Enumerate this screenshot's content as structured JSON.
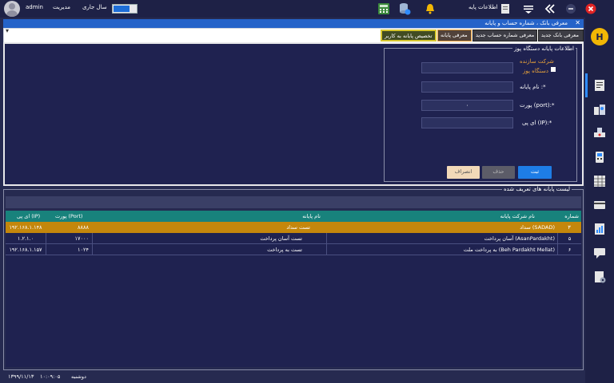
{
  "topbar": {
    "user": "admin",
    "role": "مدیریت",
    "fiscal_year_label": "سال جاری",
    "base_info_label": "اطلاعات پایه"
  },
  "window": {
    "title": "معرفی بانک ، شماره حساب و پایانه",
    "tabs": [
      "معرفی بانک جدید",
      "معرفی شماره حساب جدید",
      "معرفی پایانه",
      "تخصیص پایانه به کاربر"
    ]
  },
  "form": {
    "legend": "اطلاعات پایانه دستگاه پوز",
    "maker_label_line1": "شرکت سازنده",
    "maker_label_line2": "دستگاه پوز",
    "terminal_name_label": "نام پایانه :*",
    "port_label": "پورت (port):*",
    "port_value": "۰",
    "ip_label": "ای پی (IP):*",
    "submit": "ثبت",
    "delete": "حذف",
    "cancel": "انصراف"
  },
  "list": {
    "legend": "لیست پایانه های تعریف شده",
    "columns": [
      "شماره",
      "نام شرکت پایانه",
      "نام پایانه",
      "پورت (Port)",
      "ای پی (IP)"
    ],
    "rows": [
      [
        "۳",
        "سداد (SADAD)",
        "تست سداد",
        "۸۸۸۸",
        "۱۹۲.۱۶۸.۱.۱۴۸"
      ],
      [
        "۵",
        "آسان پرداخت (AsanPardakht)",
        "تست آسان پرداخت",
        "۱۷۰۰۰",
        "۱.۲.۱.۰"
      ],
      [
        "۶",
        "به پرداخت ملت (Beh Pardakht Mellat)",
        "تست به پرداخت",
        "۱۰۲۴",
        "۱۹۲.۱۶۸.۱.۱۵۷"
      ]
    ]
  },
  "status": {
    "date": "۱۳۹۹/۱۱/۱۳",
    "time": "۱۰:۰۹:۰۵",
    "weekday": "دوشنبه"
  }
}
